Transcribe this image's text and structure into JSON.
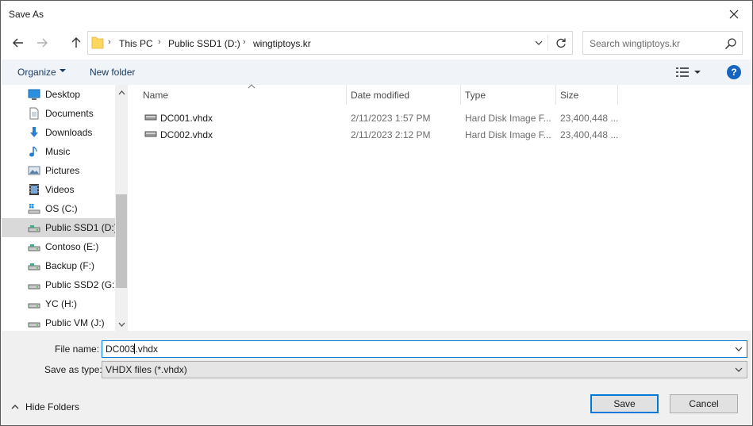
{
  "window": {
    "title": "Save As"
  },
  "address": {
    "segments": [
      "This PC",
      "Public SSD1 (D:)",
      "wingtiptoys.kr"
    ]
  },
  "search": {
    "placeholder": "Search wingtiptoys.kr"
  },
  "toolbar": {
    "organize_label": "Organize",
    "new_folder_label": "New folder",
    "help_label": "?"
  },
  "sidebar": {
    "items": [
      {
        "label": "Desktop",
        "icon": "desktop-icon"
      },
      {
        "label": "Documents",
        "icon": "documents-icon"
      },
      {
        "label": "Downloads",
        "icon": "downloads-icon"
      },
      {
        "label": "Music",
        "icon": "music-icon"
      },
      {
        "label": "Pictures",
        "icon": "pictures-icon"
      },
      {
        "label": "Videos",
        "icon": "videos-icon"
      },
      {
        "label": "OS (C:)",
        "icon": "os-drive-icon"
      },
      {
        "label": "Public SSD1 (D:)",
        "icon": "drive-icon",
        "selected": true
      },
      {
        "label": "Contoso (E:)",
        "icon": "drive-icon"
      },
      {
        "label": "Backup (F:)",
        "icon": "drive-icon"
      },
      {
        "label": "Public SSD2 (G:)",
        "icon": "drive-icon"
      },
      {
        "label": "YC (H:)",
        "icon": "drive-icon"
      },
      {
        "label": "Public VM (J:)",
        "icon": "drive-icon"
      }
    ]
  },
  "file_list": {
    "columns": [
      "Name",
      "Date modified",
      "Type",
      "Size"
    ],
    "rows": [
      {
        "name": "DC001.vhdx",
        "date": "2/11/2023 1:57 PM",
        "type": "Hard Disk Image F...",
        "size": "23,400,448 ..."
      },
      {
        "name": "DC002.vhdx",
        "date": "2/11/2023 2:12 PM",
        "type": "Hard Disk Image F...",
        "size": "23,400,448 ..."
      }
    ]
  },
  "form": {
    "file_name_label": "File name:",
    "file_name_before_caret": "DC003",
    "file_name_after_caret": ".vhdx",
    "save_as_type_label": "Save as type:",
    "save_as_type_value": "VHDX files (*.vhdx)"
  },
  "footer": {
    "hide_folders_label": "Hide Folders",
    "save_label": "Save",
    "cancel_label": "Cancel"
  },
  "colors": {
    "accent": "#0078d7",
    "toolbar_bg": "#f0f4f9",
    "selected_bg": "#d9d9d9",
    "help_blue": "#1565c0",
    "folder_yellow": "#ffd75e"
  }
}
